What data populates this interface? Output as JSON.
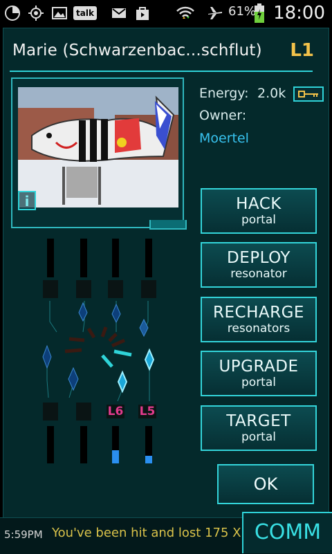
{
  "status_bar": {
    "icons": [
      "pie-chart-icon",
      "gps-icon",
      "image-icon",
      "talk-icon",
      "gmail-icon",
      "shop-icon",
      "wifi-icon",
      "airplane-icon",
      "battery-icon"
    ],
    "battery": "61%",
    "time": "18:00",
    "talk_label": "talk"
  },
  "portal": {
    "title": "Marie (Schwarzenbac...schflut)",
    "level": "L1",
    "energy_label": "Energy:",
    "energy_value": "2.0k",
    "owner_label": "Owner:",
    "owner_name": "Moertel",
    "info_label": "i"
  },
  "actions": [
    {
      "main": "HACK",
      "sub": "portal"
    },
    {
      "main": "DEPLOY",
      "sub": "resonator"
    },
    {
      "main": "RECHARGE",
      "sub": "resonators"
    },
    {
      "main": "UPGRADE",
      "sub": "portal"
    },
    {
      "main": "TARGET",
      "sub": "portal"
    }
  ],
  "ok_label": "OK",
  "resonators": [
    {
      "level": "",
      "fill": 0
    },
    {
      "level": "",
      "fill": 0
    },
    {
      "level": "L6",
      "fill": 0.35
    },
    {
      "level": "L5",
      "fill": 0.2
    }
  ],
  "comm": {
    "time": "5:59PM",
    "message": "You've been hit and lost 175 X",
    "button": "COMM"
  },
  "colors": {
    "accent": "#33d5da",
    "level": "#f3c24a",
    "owner": "#38c3f0",
    "resonator_level": "#e23b8d"
  }
}
